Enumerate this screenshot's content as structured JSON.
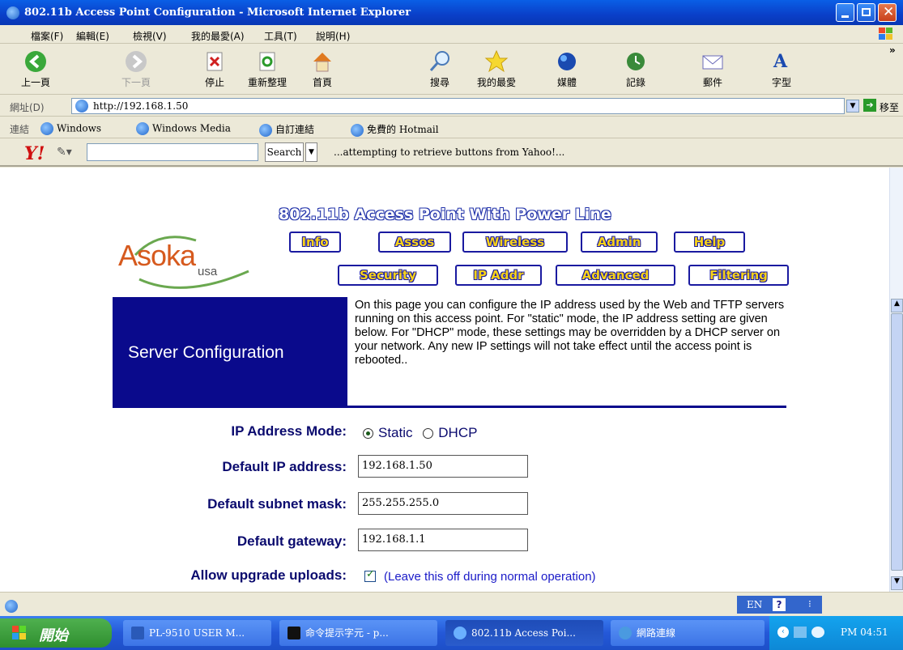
{
  "window": {
    "title": "802.11b Access Point Configuration - Microsoft Internet Explorer"
  },
  "menu": [
    "檔案(F)",
    "編輯(E)",
    "檢視(V)",
    "我的最愛(A)",
    "工具(T)",
    "說明(H)"
  ],
  "toolbar": {
    "back": "上一頁",
    "forward": "下一頁",
    "stop": "停止",
    "refresh": "重新整理",
    "home": "首頁",
    "search": "搜尋",
    "favorites": "我的最愛",
    "media": "媒體",
    "history": "記錄",
    "mail": "郵件",
    "font": "字型"
  },
  "address": {
    "label": "網址(D)",
    "url": "http://192.168.1.50",
    "go": "移至"
  },
  "links": {
    "label": "連結",
    "items": [
      "Windows",
      "Windows Media",
      "自訂連結",
      "免費的 Hotmail"
    ]
  },
  "yahoo": {
    "search_button": "Search",
    "status": "...attempting to retrieve buttons from Yahoo!..."
  },
  "page": {
    "logo_main": "Asoka",
    "logo_sub": "usa",
    "headline": "802.11b Access Point With Power Line",
    "nav_row1": [
      "Info",
      "Assos",
      "Wireless",
      "Admin",
      "Help"
    ],
    "nav_row2": [
      "Security",
      "IP Addr",
      "Advanced",
      "Filtering"
    ],
    "section_title": "Server Configuration",
    "description": "On this page you can configure the IP address used by the Web and TFTP servers running on this access point. For \"static\" mode, the IP address setting are given below. For \"DHCP\" mode, these settings may be overridden by a DHCP server on your network. Any new IP settings will not take effect until the access point is rebooted..",
    "ip_mode_label": "IP Address Mode:",
    "ip_mode_static": "Static",
    "ip_mode_dhcp": "DHCP",
    "ip_label": "Default IP address:",
    "ip_value": "192.168.1.50",
    "mask_label": "Default subnet mask:",
    "mask_value": "255.255.255.0",
    "gateway_label": "Default gateway:",
    "gateway_value": "192.168.1.1",
    "upgrade_label": "Allow upgrade uploads:",
    "upgrade_note": "(Leave this off during normal operation)"
  },
  "langbar": {
    "lang": "EN"
  },
  "taskbar": {
    "start": "開始",
    "tasks": [
      "PL-9510 USER M...",
      "命令提示字元 - p...",
      "802.11b Access Poi...",
      "網路連線"
    ],
    "clock": "PM 04:51"
  },
  "colors": {
    "nav_border": "#1a1aa0",
    "nav_text": "#f7d21a",
    "server_bg": "#0a0a8c",
    "label_text": "#0a0a6e"
  }
}
